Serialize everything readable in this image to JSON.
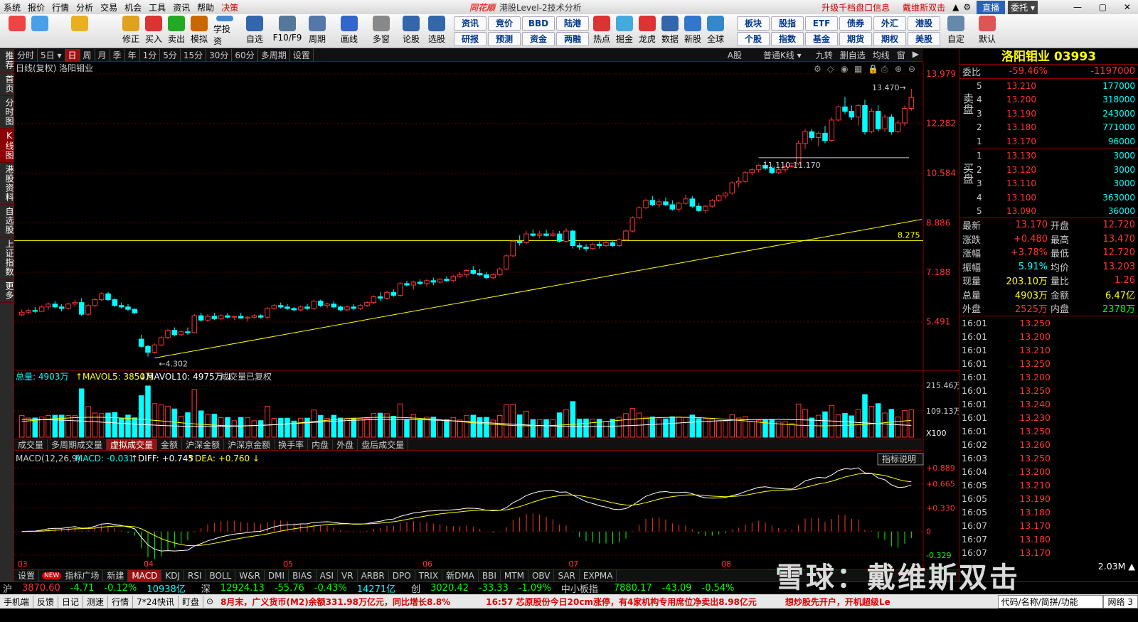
{
  "menu": [
    "系统",
    "报价",
    "行情",
    "分析",
    "交易",
    "机会",
    "工具",
    "资讯",
    "帮助"
  ],
  "menu_accent": "决策",
  "app_title": {
    "brand": "同花顺",
    "title": "港股Level-2技术分析"
  },
  "menu_right": {
    "upgrade": "升级千档盘口信息",
    "user": "戴维斯双击",
    "live": "直播",
    "entrust": "委托"
  },
  "toolbar_big": [
    {
      "label": "",
      "color": "#e44"
    },
    {
      "label": "",
      "color": "#4aa0e8"
    },
    {
      "label": "",
      "color": "#e8b020"
    },
    {
      "label": "修正",
      "color": "#e0a020"
    },
    {
      "label": "买入",
      "color": "#d33"
    },
    {
      "label": "卖出",
      "color": "#2a2"
    },
    {
      "label": "模拟",
      "color": "#c60"
    },
    {
      "label": "学投资",
      "color": "#48c"
    },
    {
      "label": "自选",
      "color": "#36a"
    },
    {
      "label": "F10/F9",
      "color": "#579"
    },
    {
      "label": "周期",
      "color": "#57a"
    },
    {
      "label": "画线",
      "color": "#36c"
    },
    {
      "label": "多窗",
      "color": "#888"
    },
    {
      "label": "论股",
      "color": "#36a"
    },
    {
      "label": "选股",
      "color": "#36a"
    }
  ],
  "toolbar_small_top": [
    "资讯",
    "竞价",
    "BBD",
    "陆港"
  ],
  "toolbar_small_bot": [
    "研报",
    "预测",
    "资金",
    "两融"
  ],
  "toolbar_big2": [
    {
      "label": "热点",
      "color": "#d33"
    },
    {
      "label": "掘金",
      "color": "#4ad"
    },
    {
      "label": "龙虎",
      "color": "#d33"
    },
    {
      "label": "数据",
      "color": "#36a"
    },
    {
      "label": "新股",
      "color": "#37c"
    },
    {
      "label": "全球",
      "color": "#38c"
    }
  ],
  "toolbar_small2_top": [
    "板块",
    "股指",
    "ETF",
    "债券",
    "外汇",
    "港股"
  ],
  "toolbar_small2_bot": [
    "个股",
    "指数",
    "基金",
    "期货",
    "期权",
    "美股"
  ],
  "toolbar_big3": [
    {
      "label": "自定",
      "color": "#68a"
    },
    {
      "label": "默认",
      "color": "#d55"
    }
  ],
  "leftbar": [
    "推荐",
    "首页",
    "分时图",
    "K线图",
    "港股资料",
    "自选股",
    "上证指数",
    "更多"
  ],
  "periods": [
    "分时",
    "5日",
    "日",
    "周",
    "月",
    "季",
    "年",
    "1分",
    "5分",
    "15分",
    "30分",
    "60分",
    "多周期",
    "设置"
  ],
  "chart_header": {
    "left": "日线(复权) 洛阳钼业",
    "a_share": "A股",
    "kline_type": "普通K线",
    "opts": [
      "九转",
      "删自选",
      "均线",
      "窗"
    ]
  },
  "stock": {
    "name": "洛阳钼业",
    "code": "03993"
  },
  "weibi": {
    "label": "委比",
    "pct": "-59.46%",
    "diff": "-1197000"
  },
  "sell_label": "卖盘",
  "buy_label": "买盘",
  "asks": [
    {
      "lv": "5",
      "price": "13.210",
      "vol": "177000"
    },
    {
      "lv": "4",
      "price": "13.200",
      "vol": "318000"
    },
    {
      "lv": "3",
      "price": "13.190",
      "vol": "243000"
    },
    {
      "lv": "2",
      "price": "13.180",
      "vol": "771000"
    },
    {
      "lv": "1",
      "price": "13.170",
      "vol": "96000"
    }
  ],
  "bids": [
    {
      "lv": "1",
      "price": "13.130",
      "vol": "3000"
    },
    {
      "lv": "2",
      "price": "13.120",
      "vol": "3000"
    },
    {
      "lv": "3",
      "price": "13.110",
      "vol": "3000"
    },
    {
      "lv": "4",
      "price": "13.100",
      "vol": "363000"
    },
    {
      "lv": "5",
      "price": "13.090",
      "vol": "36000"
    }
  ],
  "quote": [
    {
      "k": "最新",
      "v": "13.170",
      "vc": "red",
      "k2": "开盘",
      "v2": "12.720",
      "v2c": "red"
    },
    {
      "k": "涨跌",
      "v": "+0.480",
      "vc": "red",
      "k2": "最高",
      "v2": "13.470",
      "v2c": "red"
    },
    {
      "k": "涨幅",
      "v": "+3.78%",
      "vc": "red",
      "k2": "最低",
      "v2": "12.720",
      "v2c": "red"
    },
    {
      "k": "振幅",
      "v": "5.91%",
      "vc": "cyn",
      "k2": "均价",
      "v2": "13.203",
      "v2c": "red"
    },
    {
      "k": "现量",
      "v": "203.10万",
      "vc": "yel",
      "k2": "量比",
      "v2": "1.26",
      "v2c": "red"
    },
    {
      "k": "总量",
      "v": "4903万",
      "vc": "yel",
      "k2": "金额",
      "v2": "6.47亿",
      "v2c": "yel"
    },
    {
      "k": "外盘",
      "v": "2525万",
      "vc": "red",
      "k2": "内盘",
      "v2": "2378万",
      "v2c": "grn"
    }
  ],
  "ticks": [
    {
      "t": "16:01",
      "p": "13.250"
    },
    {
      "t": "16:01",
      "p": "13.200"
    },
    {
      "t": "16:01",
      "p": "13.210"
    },
    {
      "t": "16:01",
      "p": "13.250"
    },
    {
      "t": "16:01",
      "p": "13.200"
    },
    {
      "t": "16:01",
      "p": "13.250"
    },
    {
      "t": "16:01",
      "p": "13.240"
    },
    {
      "t": "16:01",
      "p": "13.230"
    },
    {
      "t": "16:01",
      "p": "13.250"
    },
    {
      "t": "16:02",
      "p": "13.260"
    },
    {
      "t": "16:03",
      "p": "13.250"
    },
    {
      "t": "16:04",
      "p": "13.200"
    },
    {
      "t": "16:05",
      "p": "13.210"
    },
    {
      "t": "16:05",
      "p": "13.190"
    },
    {
      "t": "16:05",
      "p": "13.180"
    },
    {
      "t": "16:07",
      "p": "13.170"
    },
    {
      "t": "16:07",
      "p": "13.180"
    },
    {
      "t": "16:07",
      "p": "13.170"
    }
  ],
  "tick_last_vol": "2.03M",
  "vol_header": {
    "total": "总量: 4903万",
    "mavol5": "MAVOL5: 3850万",
    "mavol10": "MAVOL10: 4975万",
    "note": "成交量已复权"
  },
  "vol_tabs": [
    "成交量",
    "多周期成交量",
    "虚拟成交量",
    "金额",
    "沪深金额",
    "沪深京金额",
    "换手率",
    "内盘",
    "外盘",
    "盘后成交量"
  ],
  "macd_header": {
    "name": "MACD(12,26,9)",
    "macd": "MACD: -0.031",
    "diff": "DIFF: +0.745",
    "dea": "DEA: +0.760",
    "explain": "指标说明"
  },
  "ind_tabs": [
    "设置",
    "指标广场",
    "新建",
    "MACD",
    "KDJ",
    "RSI",
    "BOLL",
    "W&R",
    "DMI",
    "BIAS",
    "ASI",
    "VR",
    "ARBR",
    "DPO",
    "TRIX",
    "新DMA",
    "BBI",
    "MTM",
    "OBV",
    "SAR",
    "EXPMA"
  ],
  "ind_new_badge": "NEW",
  "index_bar": [
    {
      "text": "沪",
      "c": "#ccc"
    },
    {
      "text": "3870.60",
      "c": "#f33"
    },
    {
      "text": "-4.71",
      "c": "#0f0"
    },
    {
      "text": "-0.12%",
      "c": "#0f0"
    },
    {
      "text": "10938亿",
      "c": "#0ff"
    },
    {
      "text": "深",
      "c": "#ccc"
    },
    {
      "text": "12924.13",
      "c": "#0f0"
    },
    {
      "text": "-55.76",
      "c": "#0f0"
    },
    {
      "text": "-0.43%",
      "c": "#0f0"
    },
    {
      "text": "14271亿",
      "c": "#0ff"
    },
    {
      "text": "创",
      "c": "#ccc"
    },
    {
      "text": "3020.42",
      "c": "#0f0"
    },
    {
      "text": "-33.33",
      "c": "#0f0"
    },
    {
      "text": "-1.09%",
      "c": "#0f0"
    },
    {
      "text": "中小板指",
      "c": "#ccc"
    },
    {
      "text": "7880.17",
      "c": "#0f0"
    },
    {
      "text": "-43.09",
      "c": "#0f0"
    },
    {
      "text": "-0.54%",
      "c": "#0f0"
    }
  ],
  "status": {
    "items": [
      "手机端",
      "反馈",
      "日记",
      "测速",
      "行情",
      "7*24快讯",
      "盯盘"
    ],
    "news1": "8月末，广义货币(M2)余额331.98万亿元，同比增长8.8%",
    "news2": "16:57 芯原股份今日20cm涨停，有4家机构专用席位净卖出8.98亿元",
    "news3": "想炒股先开户，开机超级Le",
    "search": "代码/名称/简拼/功能",
    "net": "网络 3"
  },
  "watermark": "雪球：戴维斯双击",
  "chart_data": {
    "type": "candlestick",
    "title": "日线(复权) 洛阳钼业",
    "price_axis": {
      "min": 4.302,
      "max": 13.979,
      "ticks": [
        13.979,
        12.282,
        10.584,
        8.886,
        7.188,
        5.491
      ]
    },
    "x_ticks": [
      {
        "label": "03",
        "i": 0
      },
      {
        "label": "04",
        "i": 19
      },
      {
        "label": "05",
        "i": 40
      },
      {
        "label": "06",
        "i": 61
      },
      {
        "label": "07",
        "i": 83
      },
      {
        "label": "08",
        "i": 106
      }
    ],
    "annotations": [
      {
        "text": "13.470",
        "i": 133,
        "price": 13.47
      },
      {
        "text": "4.302",
        "i": 20,
        "price": 4.302
      },
      {
        "text": "11.110-11.170",
        "i": 111,
        "price": 11.11
      },
      {
        "text": "8.275",
        "i": 139,
        "price": 8.275
      }
    ],
    "horizontal_line": 8.275,
    "trendline": [
      {
        "i": 20,
        "price": 4.302
      },
      {
        "i": 139,
        "price": 9.0
      }
    ],
    "ohlc": [
      [
        5.73,
        5.92,
        5.68,
        5.82
      ],
      [
        5.82,
        5.95,
        5.75,
        5.88
      ],
      [
        5.88,
        6.0,
        5.8,
        5.85
      ],
      [
        5.85,
        6.05,
        5.83,
        6.0
      ],
      [
        6.0,
        6.15,
        5.9,
        6.1
      ],
      [
        6.1,
        6.2,
        5.95,
        6.0
      ],
      [
        6.0,
        6.1,
        5.85,
        5.95
      ],
      [
        5.95,
        6.15,
        5.9,
        6.1
      ],
      [
        6.1,
        6.25,
        6.0,
        6.15
      ],
      [
        6.15,
        6.3,
        5.7,
        5.75
      ],
      [
        5.75,
        6.1,
        5.7,
        6.05
      ],
      [
        6.05,
        6.3,
        6.0,
        6.25
      ],
      [
        6.25,
        6.5,
        6.2,
        6.45
      ],
      [
        6.45,
        6.5,
        6.2,
        6.25
      ],
      [
        6.25,
        6.3,
        6.0,
        6.05
      ],
      [
        6.05,
        6.15,
        5.95,
        6.0
      ],
      [
        6.0,
        6.1,
        5.85,
        5.92
      ],
      [
        5.92,
        5.95,
        5.75,
        5.8
      ],
      [
        4.9,
        5.05,
        4.6,
        4.65
      ],
      [
        4.65,
        4.7,
        4.302,
        4.45
      ],
      [
        4.45,
        4.75,
        4.4,
        4.7
      ],
      [
        4.7,
        5.0,
        4.65,
        4.95
      ],
      [
        4.95,
        5.25,
        4.9,
        5.2
      ],
      [
        5.2,
        5.3,
        5.0,
        5.05
      ],
      [
        5.05,
        5.2,
        5.0,
        5.15
      ],
      [
        5.15,
        5.3,
        5.05,
        5.12
      ],
      [
        5.12,
        5.75,
        5.1,
        5.7
      ],
      [
        5.7,
        5.8,
        5.5,
        5.55
      ],
      [
        5.55,
        5.75,
        5.5,
        5.68
      ],
      [
        5.68,
        5.8,
        5.55,
        5.6
      ],
      [
        5.6,
        5.75,
        5.55,
        5.7
      ],
      [
        5.7,
        5.8,
        5.6,
        5.65
      ],
      [
        5.65,
        5.7,
        5.55,
        5.68
      ],
      [
        5.68,
        5.8,
        5.6,
        5.62
      ],
      [
        5.62,
        5.7,
        5.5,
        5.65
      ],
      [
        5.65,
        5.75,
        5.6,
        5.7
      ],
      [
        5.7,
        5.75,
        5.6,
        5.65
      ],
      [
        5.65,
        6.0,
        5.6,
        5.95
      ],
      [
        5.95,
        6.1,
        5.9,
        6.05
      ],
      [
        6.05,
        6.15,
        5.95,
        6.0
      ],
      [
        6.0,
        6.1,
        5.9,
        5.95
      ],
      [
        5.95,
        6.0,
        5.85,
        5.9
      ],
      [
        5.9,
        6.05,
        5.85,
        6.0
      ],
      [
        6.0,
        6.1,
        5.9,
        5.95
      ],
      [
        5.95,
        6.25,
        5.9,
        6.2
      ],
      [
        6.2,
        6.25,
        6.0,
        6.05
      ],
      [
        6.05,
        6.15,
        5.95,
        6.1
      ],
      [
        6.1,
        6.2,
        5.95,
        6.0
      ],
      [
        6.0,
        6.05,
        5.85,
        5.9
      ],
      [
        5.9,
        6.05,
        5.85,
        6.0
      ],
      [
        6.0,
        6.1,
        5.9,
        5.95
      ],
      [
        5.95,
        6.1,
        5.9,
        6.05
      ],
      [
        6.05,
        6.2,
        6.0,
        6.15
      ],
      [
        6.15,
        6.4,
        6.1,
        6.35
      ],
      [
        6.35,
        6.5,
        6.2,
        6.3
      ],
      [
        6.3,
        6.55,
        6.25,
        6.5
      ],
      [
        6.5,
        6.6,
        6.35,
        6.4
      ],
      [
        6.4,
        6.85,
        6.35,
        6.8
      ],
      [
        6.8,
        6.9,
        6.7,
        6.75
      ],
      [
        6.75,
        6.9,
        6.6,
        6.85
      ],
      [
        6.85,
        6.95,
        6.75,
        6.8
      ],
      [
        6.8,
        6.95,
        6.7,
        6.9
      ],
      [
        6.9,
        7.0,
        6.75,
        6.85
      ],
      [
        6.85,
        7.0,
        6.8,
        6.95
      ],
      [
        6.95,
        7.05,
        6.85,
        6.9
      ],
      [
        6.9,
        7.1,
        6.85,
        7.05
      ],
      [
        7.05,
        7.2,
        7.0,
        7.1
      ],
      [
        7.1,
        7.3,
        7.0,
        7.25
      ],
      [
        7.25,
        7.4,
        7.1,
        7.15
      ],
      [
        7.15,
        7.3,
        7.05,
        7.1
      ],
      [
        7.1,
        7.2,
        6.95,
        7.0
      ],
      [
        7.0,
        7.15,
        6.95,
        7.1
      ],
      [
        7.1,
        7.35,
        7.05,
        7.3
      ],
      [
        7.3,
        7.8,
        7.25,
        7.75
      ],
      [
        7.75,
        8.3,
        7.7,
        8.25
      ],
      [
        8.25,
        8.45,
        8.1,
        8.2
      ],
      [
        8.2,
        8.6,
        8.15,
        8.5
      ],
      [
        8.5,
        8.65,
        8.4,
        8.45
      ],
      [
        8.45,
        8.6,
        8.35,
        8.5
      ],
      [
        8.5,
        8.65,
        8.4,
        8.45
      ],
      [
        8.45,
        8.65,
        8.4,
        8.5
      ],
      [
        8.5,
        8.6,
        8.2,
        8.25
      ],
      [
        8.25,
        8.7,
        8.2,
        8.6
      ],
      [
        8.6,
        8.65,
        8.0,
        8.1
      ],
      [
        8.1,
        8.2,
        7.95,
        8.05
      ],
      [
        8.05,
        8.15,
        7.9,
        8.0
      ],
      [
        8.0,
        8.2,
        7.95,
        8.15
      ],
      [
        8.15,
        8.25,
        8.0,
        8.1
      ],
      [
        8.1,
        8.25,
        8.05,
        8.2
      ],
      [
        8.2,
        8.3,
        8.05,
        8.1
      ],
      [
        8.1,
        8.35,
        8.05,
        8.3
      ],
      [
        8.3,
        8.65,
        8.25,
        8.6
      ],
      [
        8.6,
        9.1,
        8.55,
        9.05
      ],
      [
        9.05,
        9.45,
        9.0,
        9.4
      ],
      [
        9.4,
        9.7,
        9.35,
        9.65
      ],
      [
        9.65,
        9.8,
        9.45,
        9.5
      ],
      [
        9.5,
        9.7,
        9.4,
        9.6
      ],
      [
        9.6,
        9.75,
        9.45,
        9.5
      ],
      [
        9.5,
        9.65,
        9.3,
        9.35
      ],
      [
        9.35,
        9.6,
        9.25,
        9.55
      ],
      [
        9.55,
        9.85,
        9.5,
        9.7
      ],
      [
        9.7,
        9.8,
        9.4,
        9.45
      ],
      [
        9.45,
        9.55,
        9.25,
        9.3
      ],
      [
        9.3,
        9.5,
        9.2,
        9.45
      ],
      [
        9.45,
        9.7,
        9.4,
        9.65
      ],
      [
        9.65,
        9.85,
        9.6,
        9.8
      ],
      [
        9.8,
        9.95,
        9.7,
        9.9
      ],
      [
        9.9,
        10.3,
        9.85,
        10.25
      ],
      [
        10.25,
        10.45,
        10.1,
        10.3
      ],
      [
        10.3,
        10.65,
        10.25,
        10.6
      ],
      [
        10.6,
        10.75,
        10.5,
        10.7
      ],
      [
        10.7,
        10.9,
        10.6,
        10.85
      ],
      [
        10.85,
        11.0,
        10.7,
        10.75
      ],
      [
        10.75,
        10.85,
        10.55,
        10.6
      ],
      [
        10.6,
        10.8,
        10.55,
        10.7
      ],
      [
        10.7,
        10.85,
        10.6,
        10.8
      ],
      [
        10.8,
        10.95,
        10.75,
        10.9
      ],
      [
        10.9,
        11.7,
        10.85,
        11.6
      ],
      [
        11.6,
        12.1,
        11.4,
        12.0
      ],
      [
        12.0,
        12.1,
        11.7,
        11.8
      ],
      [
        11.8,
        12.0,
        11.5,
        11.95
      ],
      [
        11.95,
        12.2,
        11.6,
        11.7
      ],
      [
        11.7,
        12.5,
        11.65,
        12.4
      ],
      [
        12.4,
        12.9,
        12.35,
        12.85
      ],
      [
        12.85,
        13.2,
        12.6,
        12.7
      ],
      [
        12.7,
        12.9,
        12.4,
        12.5
      ],
      [
        12.5,
        12.95,
        12.2,
        12.9
      ],
      [
        12.9,
        13.1,
        11.9,
        12.0
      ],
      [
        12.0,
        12.8,
        11.95,
        12.7
      ],
      [
        12.7,
        12.9,
        12.0,
        12.1
      ],
      [
        12.1,
        12.6,
        12.0,
        12.5
      ],
      [
        12.5,
        12.6,
        11.9,
        12.0
      ],
      [
        12.0,
        12.4,
        11.95,
        12.3
      ],
      [
        12.3,
        12.9,
        12.2,
        12.8
      ],
      [
        12.8,
        13.47,
        12.72,
        13.17
      ]
    ],
    "volume_axis": {
      "ticks": [
        "215.46万",
        "109.13万"
      ],
      "unit": "X100"
    },
    "macd_axis": {
      "ticks": [
        "+0.889",
        "+0.665",
        "+0.330",
        "0",
        "-0.329"
      ]
    }
  }
}
